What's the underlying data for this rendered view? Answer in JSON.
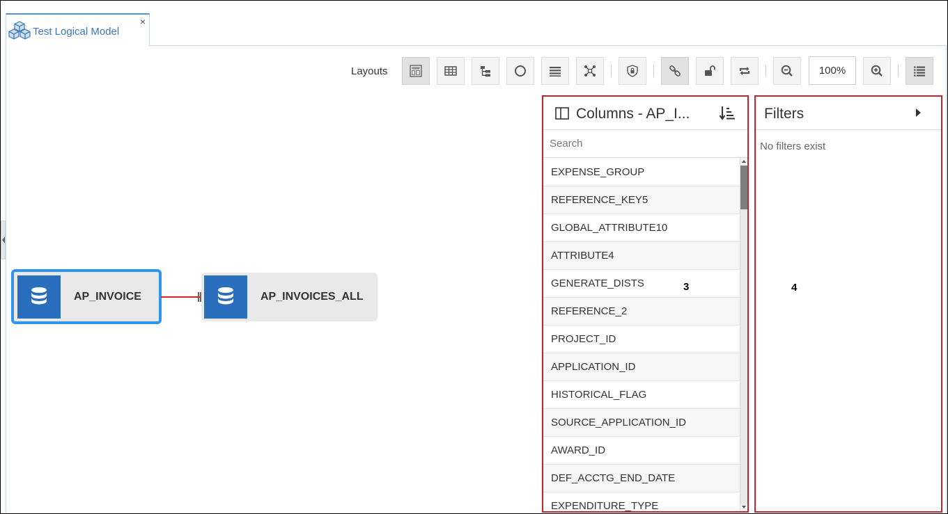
{
  "tab": {
    "title": "Test Logical Model",
    "close_symbol": "×",
    "icon": "cubes-icon"
  },
  "toolbar": {
    "layouts_label": "Layouts",
    "buttons": [
      "layout-default",
      "table-layout",
      "tree-layout",
      "circle-layout",
      "list-layout",
      "organic-layout",
      "security",
      "link",
      "unlock",
      "swap",
      "zoom-out",
      "zoom-in",
      "properties"
    ],
    "zoom_value": "100%"
  },
  "canvas": {
    "nodes": [
      {
        "label": "AP_INVOICE",
        "selected": true
      },
      {
        "label": "AP_INVOICES_ALL",
        "selected": false
      }
    ],
    "accent": "#2a6fbe",
    "selection_color": "#2d95f0",
    "connector_color": "#dd2222"
  },
  "columns_panel": {
    "title": "Columns - AP_I...",
    "search_placeholder": "Search",
    "items": [
      "EXPENSE_GROUP",
      "REFERENCE_KEY5",
      "GLOBAL_ATTRIBUTE10",
      "ATTRIBUTE4",
      "GENERATE_DISTS",
      "REFERENCE_2",
      "PROJECT_ID",
      "APPLICATION_ID",
      "HISTORICAL_FLAG",
      "SOURCE_APPLICATION_ID",
      "AWARD_ID",
      "DEF_ACCTG_END_DATE",
      "EXPENDITURE_TYPE"
    ]
  },
  "filters_panel": {
    "title": "Filters",
    "empty_text": "No filters exist"
  },
  "annotations": {
    "columns": "3",
    "filters": "4"
  },
  "highlight_color": "#c0272d"
}
